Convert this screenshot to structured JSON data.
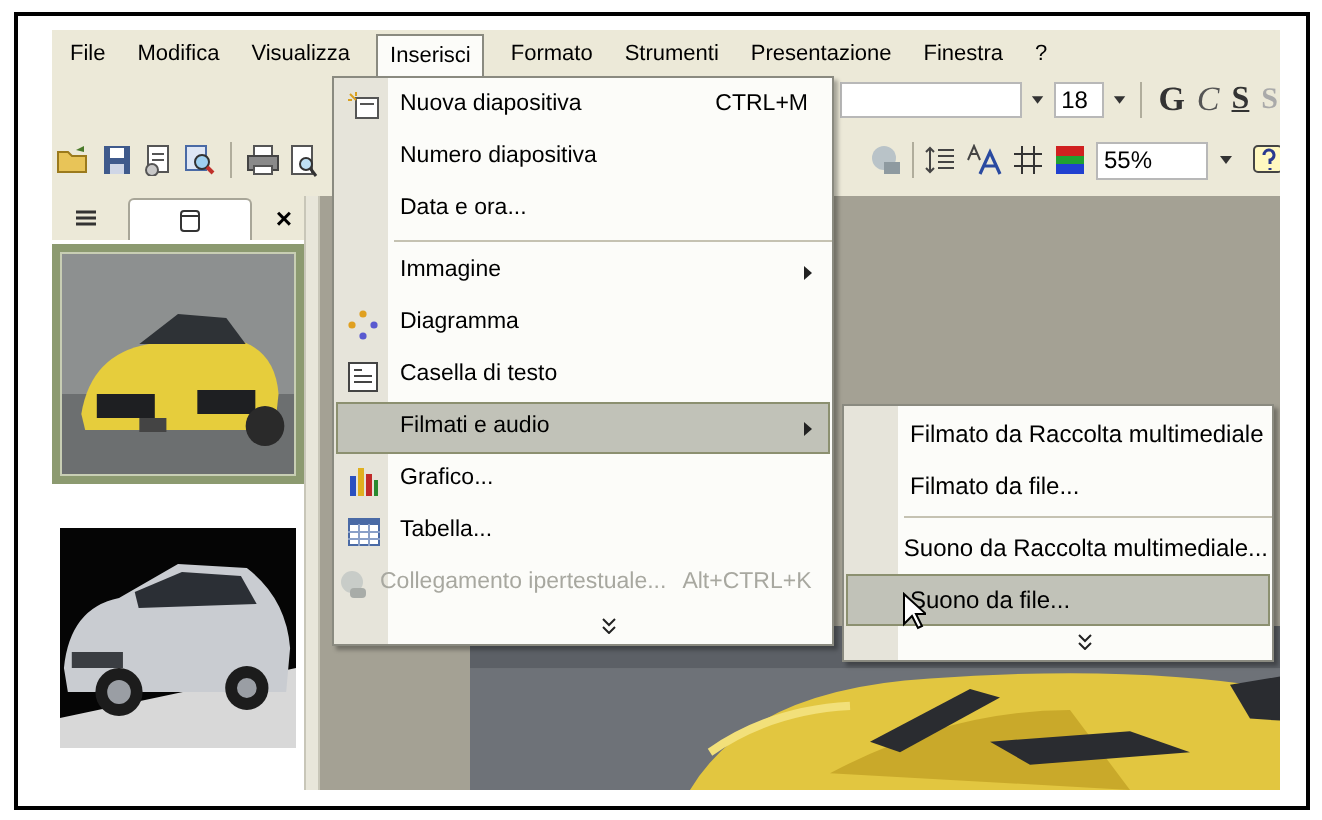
{
  "menu_bar": [
    {
      "label": "File",
      "selected": false
    },
    {
      "label": "Modifica",
      "selected": false
    },
    {
      "label": "Visualizza",
      "selected": false
    },
    {
      "label": "Inserisci",
      "selected": true
    },
    {
      "label": "Formato",
      "selected": false
    },
    {
      "label": "Strumenti",
      "selected": false
    },
    {
      "label": "Presentazione",
      "selected": false
    },
    {
      "label": "Finestra",
      "selected": false
    },
    {
      "label": "?",
      "selected": false
    }
  ],
  "formatting_toolbar": {
    "font_size": "18",
    "style_buttons": [
      "G",
      "C",
      "S",
      "S"
    ],
    "zoom": "55%"
  },
  "slide_panel": {
    "tabs": [
      {
        "kind": "outline",
        "selected": false
      },
      {
        "kind": "slides",
        "selected": true
      }
    ],
    "close": "×",
    "thumbnails": [
      {
        "kind": "picture",
        "selected": true
      },
      {
        "kind": "picture",
        "selected": false
      }
    ]
  },
  "insert_menu": {
    "items": [
      {
        "kind": "item",
        "label": "Nuova diapositiva",
        "shortcut": "CTRL+M",
        "disabled": false,
        "selected": false,
        "submenu": false
      },
      {
        "kind": "item",
        "label": "Numero diapositiva",
        "disabled": false,
        "selected": false,
        "submenu": false
      },
      {
        "kind": "item",
        "label": "Data e ora...",
        "disabled": false,
        "selected": false,
        "submenu": false
      },
      {
        "kind": "separator"
      },
      {
        "kind": "item",
        "label": "Immagine",
        "disabled": false,
        "selected": false,
        "submenu": true
      },
      {
        "kind": "item",
        "label": "Diagramma",
        "disabled": false,
        "selected": false,
        "submenu": false
      },
      {
        "kind": "item",
        "label": "Casella di testo",
        "disabled": false,
        "selected": false,
        "submenu": false
      },
      {
        "kind": "item",
        "label": "Filmati e audio",
        "disabled": false,
        "selected": true,
        "submenu": true
      },
      {
        "kind": "item",
        "label": "Grafico...",
        "disabled": false,
        "selected": false,
        "submenu": false
      },
      {
        "kind": "item",
        "label": "Tabella...",
        "disabled": false,
        "selected": false,
        "submenu": false
      },
      {
        "kind": "item",
        "label": "Collegamento ipertestuale...",
        "shortcut": "Alt+CTRL+K",
        "disabled": true,
        "selected": false,
        "submenu": false
      },
      {
        "kind": "expand"
      }
    ]
  },
  "media_submenu": {
    "items": [
      {
        "kind": "item",
        "label": "Filmato da Raccolta multimediale",
        "selected": false
      },
      {
        "kind": "item",
        "label": "Filmato da file...",
        "selected": false
      },
      {
        "kind": "separator"
      },
      {
        "kind": "item",
        "label": "Suono da Raccolta multimediale...",
        "selected": false
      },
      {
        "kind": "item",
        "label": "Suono da file...",
        "selected": true
      },
      {
        "kind": "expand"
      }
    ]
  }
}
